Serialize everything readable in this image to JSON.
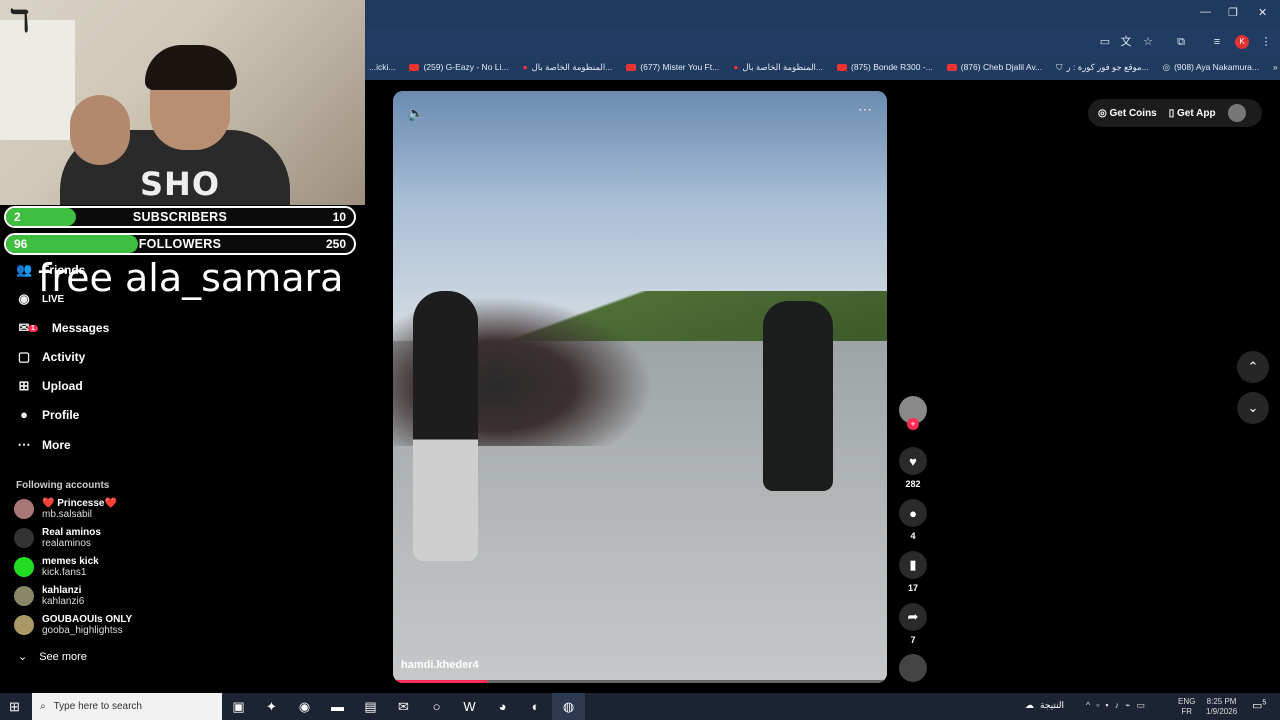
{
  "browser": {
    "bookmarks": [
      {
        "label": "...icki...",
        "icon": "none"
      },
      {
        "label": "(259) G-Eazy - No Li...",
        "icon": "youtube-icon"
      },
      {
        "label": "المنظومة الخاصة بال...",
        "icon": "red-circle-icon"
      },
      {
        "label": "(677) Mister You Ft...",
        "icon": "youtube-icon"
      },
      {
        "label": "المنظومة الخاصة بال...",
        "icon": "red-circle-icon"
      },
      {
        "label": "(875) Bonde R300 -...",
        "icon": "youtube-icon"
      },
      {
        "label": "(876) Cheb Djalil Av...",
        "icon": "youtube-icon"
      },
      {
        "label": "موقع جو فور كورة : ر...",
        "icon": "shield-icon"
      },
      {
        "label": "(908) Aya Nakamura...",
        "icon": "globe-icon"
      }
    ],
    "window_controls": {
      "minimize": "—",
      "restore": "❐",
      "close": "✕"
    },
    "profile_initial": "K"
  },
  "stream_overlay": {
    "subscribers": {
      "current": "2",
      "label": "SUBSCRIBERS",
      "goal": "10",
      "progress": 0.2
    },
    "followers": {
      "current": "96",
      "label": "FOLLOWERS",
      "goal": "250",
      "progress": 0.38
    },
    "free_text": "free ala_samara",
    "sweatshirt_text": "SHO"
  },
  "sidebar": {
    "items": [
      {
        "label": "Friends",
        "icon": "friends-icon"
      },
      {
        "label": "LIVE",
        "icon": "live-icon"
      },
      {
        "label": "Messages",
        "icon": "messages-icon",
        "badge": "1"
      },
      {
        "label": "Activity",
        "icon": "activity-icon"
      },
      {
        "label": "Upload",
        "icon": "upload-icon"
      },
      {
        "label": "Profile",
        "icon": "profile-icon"
      },
      {
        "label": "More",
        "icon": "more-icon"
      }
    ],
    "following_heading": "Following accounts",
    "following": [
      {
        "name": "❤️ Princesse❤️",
        "username": "mb.salsabil"
      },
      {
        "name": "Real aminos",
        "username": "realaminos"
      },
      {
        "name": "memes kick",
        "username": "kick.fans1"
      },
      {
        "name": "kahlanzi",
        "username": "kahlanzi6"
      },
      {
        "name": "GOUBAOUIs ONLY",
        "username": "gooba_highlightss"
      }
    ],
    "see_more": "See more"
  },
  "video": {
    "author": "hamdi.kheder4",
    "progress": 0.19,
    "likes": "282",
    "comments": "4",
    "saves": "17",
    "shares": "7"
  },
  "header_right": {
    "get_coins": "Get Coins",
    "get_app": "Get App"
  },
  "taskbar": {
    "search_placeholder": "Type here to search",
    "weather": "النتيجة",
    "lang_top": "ENG",
    "lang_bottom": "FR",
    "time": "8:25 PM",
    "date": "1/9/2026",
    "notif_count": "5"
  },
  "colors": {
    "accent": "#fe2c55",
    "bar_fill": "#3fbf3f",
    "taskbar": "#1c2433",
    "chrome": "#203a60"
  }
}
